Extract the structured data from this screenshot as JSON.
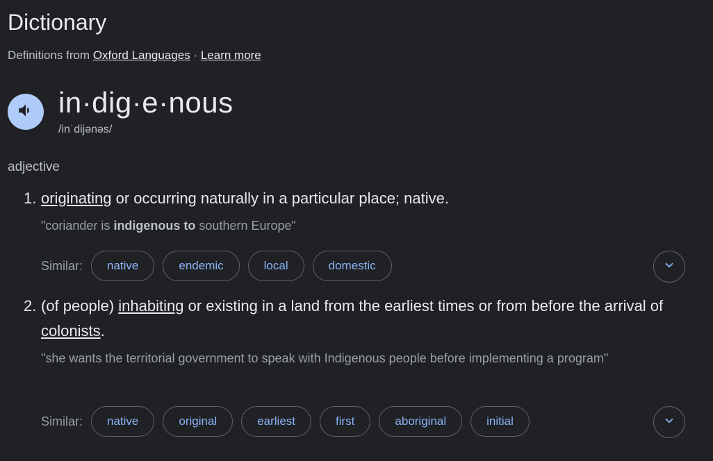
{
  "header": {
    "title": "Dictionary",
    "source_prefix": "Definitions from ",
    "source_link": "Oxford Languages",
    "separator": " · ",
    "learn_more": "Learn more"
  },
  "entry": {
    "word": "in·dig·e·nous",
    "phonetic": "/inˈdijənəs/",
    "part_of_speech": "adjective"
  },
  "definitions": [
    {
      "number": "1.",
      "link1": "originating",
      "text1": " or occurring naturally in a particular place; native.",
      "example_pre": "\"coriander is ",
      "example_bold": "indigenous to",
      "example_post": " southern Europe\"",
      "similar_label": "Similar:",
      "similar": [
        "native",
        "endemic",
        "local",
        "domestic"
      ]
    },
    {
      "number": "2.",
      "text0": "(of people) ",
      "link1": "inhabiting",
      "text1": " or existing in a land from the earliest times or from before the arrival of ",
      "link2": "colonists",
      "text2": ".",
      "example": "\"she wants the territorial government to speak with Indigenous people before implementing a program\"",
      "similar_label": "Similar:",
      "similar": [
        "native",
        "original",
        "earliest",
        "first",
        "aboriginal",
        "initial"
      ]
    }
  ],
  "colors": {
    "background": "#202124",
    "chip_text": "#8ab4f8",
    "speaker_bg": "#aecbfa"
  },
  "icons": [
    "speaker-icon",
    "chevron-down-icon"
  ]
}
